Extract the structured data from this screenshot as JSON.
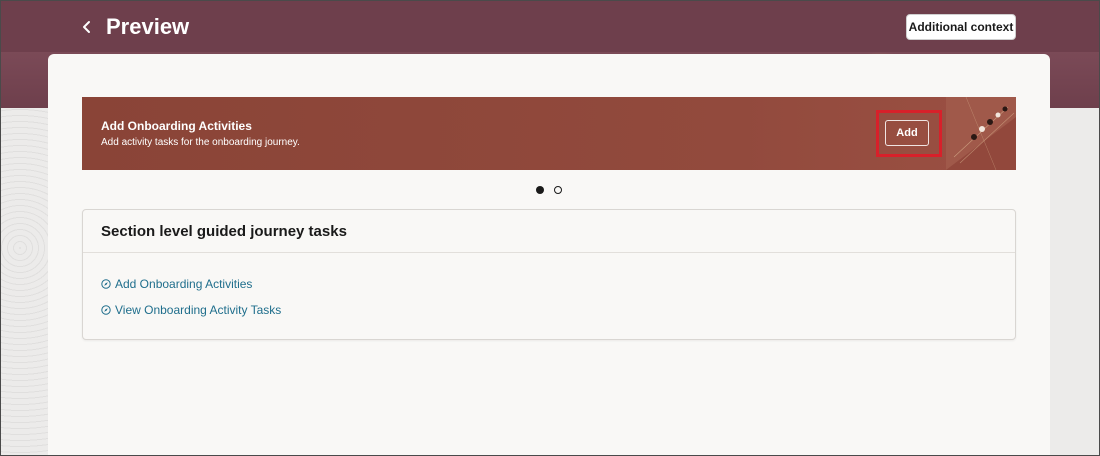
{
  "header": {
    "title": "Preview",
    "back_icon": "chevron-left-icon",
    "context_button": "Additional context"
  },
  "banner": {
    "title": "Add Onboarding Activities",
    "subtitle": "Add activity tasks for the onboarding journey.",
    "add_button": "Add"
  },
  "carousel": {
    "count": 2,
    "active_index": 0
  },
  "section": {
    "title": "Section level guided journey tasks",
    "tasks": [
      {
        "label": "Add Onboarding Activities",
        "icon": "compass-icon"
      },
      {
        "label": "View Onboarding Activity Tasks",
        "icon": "compass-icon"
      }
    ]
  },
  "colors": {
    "header_bg": "#6e3f4c",
    "banner_bg": "#8a4437",
    "link": "#1f6e8c",
    "highlight": "#d8202a"
  }
}
